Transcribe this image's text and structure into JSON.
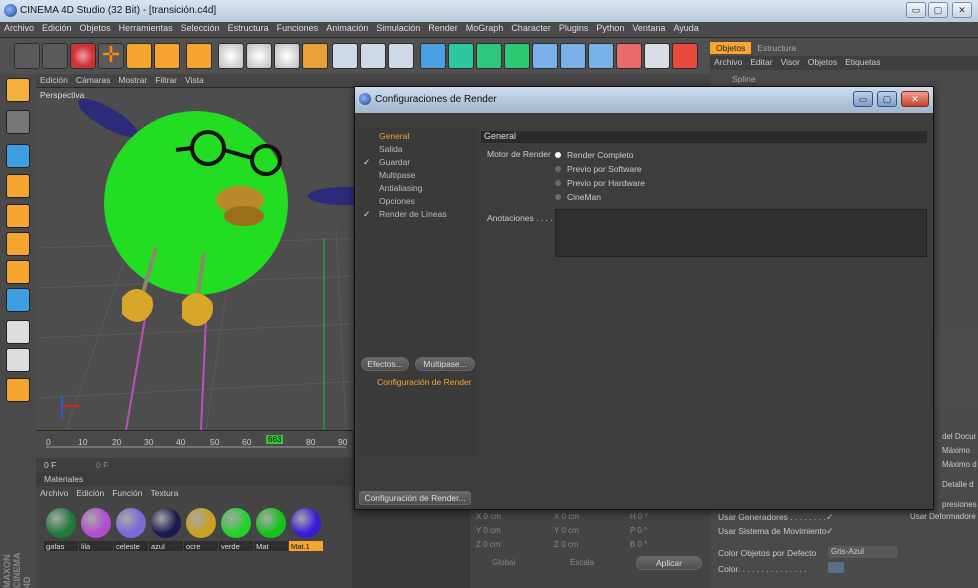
{
  "window": {
    "title": "CINEMA 4D Studio (32 Bit) - [transición.c4d]",
    "minimize_glyph": "▭",
    "maximize_glyph": "▢",
    "close_glyph": "✕"
  },
  "menubar": [
    "Archivo",
    "Edición",
    "Objetos",
    "Herramientas",
    "Selección",
    "Estructura",
    "Funciones",
    "Animación",
    "Simulación",
    "Render",
    "MoGraph",
    "Character",
    "Plugins",
    "Python",
    "Ventana",
    "Ayuda"
  ],
  "viewport": {
    "menu": [
      "Edición",
      "Cámaras",
      "Mostrar",
      "Filtrar",
      "Vista"
    ],
    "label": "Perspectiva"
  },
  "timeline": {
    "ticks": [
      "0",
      "10",
      "20",
      "30",
      "40",
      "50",
      "60",
      "70",
      "80",
      "90"
    ],
    "current_frame": "663",
    "start_frame": "0 F",
    "end_frame": "0 F"
  },
  "materials": {
    "header": "Materiales",
    "menu": [
      "Archivo",
      "Edición",
      "Función",
      "Textura"
    ],
    "items": [
      {
        "label": "gafas",
        "color": "#1f7a3a"
      },
      {
        "label": "lila",
        "color": "#b24cd1"
      },
      {
        "label": "celeste",
        "color": "#7a6ad8"
      },
      {
        "label": "azul",
        "color": "#1a1a50"
      },
      {
        "label": "ocre",
        "color": "#c8a21c"
      },
      {
        "label": "verde",
        "color": "#22d12a"
      },
      {
        "label": "Mat",
        "color": "#11c41a"
      },
      {
        "label": "Mat.1",
        "color": "#3a1ad8"
      }
    ]
  },
  "coords": {
    "x": "X 0 cm",
    "y": "Y 0 cm",
    "z": "Z 0 cm",
    "sx": "X 0 cm",
    "sy": "Y 0 cm",
    "sz": "Z 0 cm",
    "h": "H 0 °",
    "p": "P 0 °",
    "b": "B 0 °",
    "mode1": "Global",
    "mode2": "Escala",
    "apply": "Aplicar"
  },
  "objects": {
    "tabs": [
      "Objetos",
      "Estructura"
    ],
    "menu": [
      "Archivo",
      "Editar",
      "Visor",
      "Objetos",
      "Etiquetas"
    ],
    "first_item": "Spline"
  },
  "attributes": {
    "right_labels": [
      "del Docur",
      "Máximo",
      "Máximo d",
      "Detalle d",
      "presiones",
      "Usar Deformadore"
    ],
    "rows": [
      {
        "label": "Usar Generadores . . . . . . . .",
        "check": "✓"
      },
      {
        "label": "Usar Sistema de Movimiento",
        "check": "✓"
      }
    ],
    "color_label": "Color Objetos por Defecto",
    "color_value": "Gris-Azul",
    "color2_label": "Color. . . . . . . . . . . . . . ."
  },
  "dialog": {
    "title": "Configuraciones de Render",
    "tree": [
      {
        "label": "General",
        "checked": false,
        "selected": true
      },
      {
        "label": "Salida",
        "checked": false
      },
      {
        "label": "Guardar",
        "checked": true
      },
      {
        "label": "Multipase",
        "checked": false
      },
      {
        "label": "Antialiasing",
        "checked": false
      },
      {
        "label": "Opciones",
        "checked": false
      },
      {
        "label": "Render de Líneas",
        "checked": true
      }
    ],
    "section": "General",
    "engine_label": "Motor de Render",
    "engine_options": [
      "Render Completo",
      "Previo por Software",
      "Previo por Hardware",
      "CineMan"
    ],
    "engine_selected": 0,
    "annotations_label": "Anotaciones . . . .",
    "effects_btn": "Efectos...",
    "multipass_btn": "Multipase...",
    "config_item": "Configuración de Render",
    "config_btn": "Configuración de Render..."
  },
  "brand": "MAXON CINEMA 4D"
}
